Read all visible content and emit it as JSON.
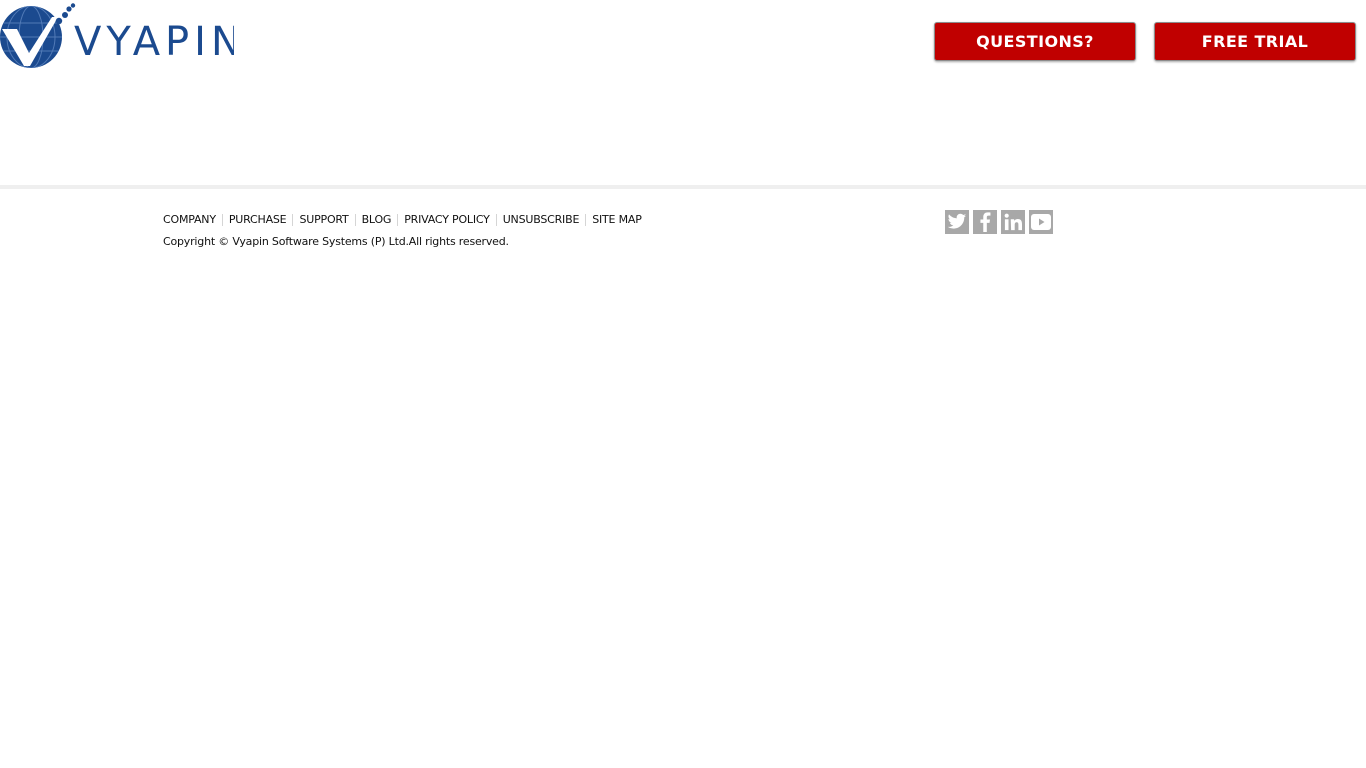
{
  "header": {
    "logo": {
      "text": "VYAPIN",
      "icon": "globe-checkmark-logo-icon",
      "brand_color": "#1b4a8f"
    },
    "buttons": [
      {
        "label": "QUESTIONS?",
        "color": "#c00000"
      },
      {
        "label": "FREE TRIAL",
        "color": "#c00000"
      }
    ]
  },
  "footer": {
    "links": [
      {
        "label": "COMPANY"
      },
      {
        "label": "PURCHASE"
      },
      {
        "label": "SUPPORT"
      },
      {
        "label": "BLOG"
      },
      {
        "label": "PRIVACY POLICY"
      },
      {
        "label": "UNSUBSCRIBE"
      },
      {
        "label": "SITE MAP"
      }
    ],
    "copyright": "Copyright © Vyapin Software Systems (P) Ltd.All rights reserved.",
    "social": [
      {
        "icon": "twitter-icon"
      },
      {
        "icon": "facebook-icon"
      },
      {
        "icon": "linkedin-icon"
      },
      {
        "icon": "youtube-icon"
      }
    ],
    "social_color": "#a8a8a8"
  }
}
